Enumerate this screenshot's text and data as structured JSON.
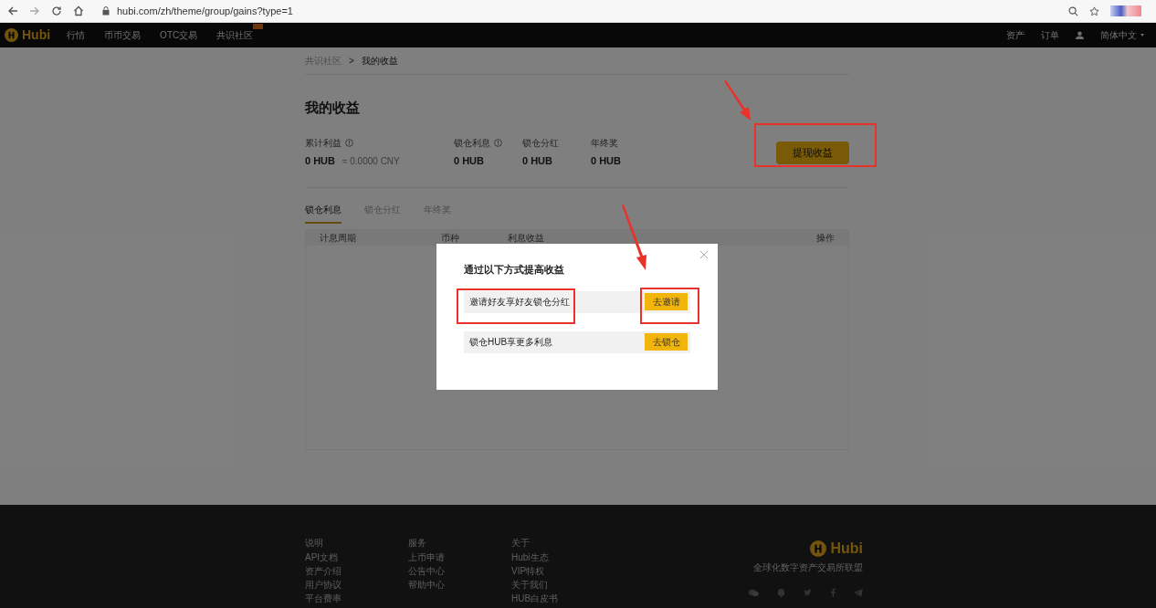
{
  "browser": {
    "url": "hubi.com/zh/theme/group/gains?type=1"
  },
  "nav": {
    "logo": "Hubi",
    "items": [
      {
        "label": "行情",
        "badge": false
      },
      {
        "label": "币币交易",
        "badge": false
      },
      {
        "label": "OTC交易",
        "badge": false
      },
      {
        "label": "共识社区",
        "badge": true
      }
    ],
    "right": [
      "资产",
      "订单"
    ],
    "language": "简体中文"
  },
  "breadcrumb": {
    "parent": "共识社区",
    "separator": ">",
    "current": "我的收益"
  },
  "title": "我的收益",
  "stats": [
    {
      "label": "累计利益",
      "info": true,
      "value": "0 HUB",
      "approx": "≈ 0.0000 CNY"
    },
    {
      "label": "锁仓利息",
      "info": true,
      "value": "0 HUB"
    },
    {
      "label": "锁仓分红",
      "info": false,
      "value": "0 HUB"
    },
    {
      "label": "年终奖",
      "info": false,
      "value": "0 HUB"
    }
  ],
  "withdraw_button": "提现收益",
  "tabs": [
    {
      "label": "锁仓利息",
      "selected": true
    },
    {
      "label": "锁仓分红",
      "selected": false
    },
    {
      "label": "年终奖",
      "selected": false
    }
  ],
  "table": {
    "columns": [
      "计息周期",
      "币种",
      "利息收益",
      "操作"
    ]
  },
  "dialog": {
    "title": "通过以下方式提高收益",
    "options": [
      {
        "text": "邀请好友享好友锁仓分红",
        "button": "去邀请"
      },
      {
        "text": "锁仓HUB享更多利息",
        "button": "去锁仓"
      }
    ]
  },
  "footer": {
    "columns": [
      {
        "heading": "说明",
        "links": [
          "API文档",
          "资产介绍",
          "用户协议",
          "平台费率"
        ]
      },
      {
        "heading": "服务",
        "links": [
          "上币申请",
          "公告中心",
          "帮助中心"
        ]
      },
      {
        "heading": "关于",
        "links": [
          "Hubi生态",
          "VIP特权",
          "关于我们",
          "HUB白皮书"
        ]
      }
    ],
    "logo": "Hubi",
    "tagline": "全球化数字资产交易所联盟"
  }
}
